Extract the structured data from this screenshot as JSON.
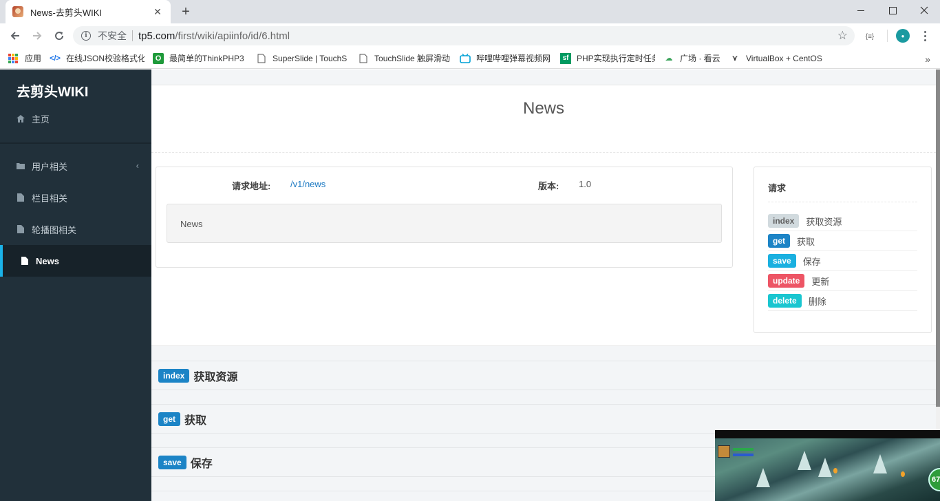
{
  "browser": {
    "tab_title": "News-去剪头WIKI",
    "address": {
      "security_label": "不安全",
      "host": "tp5.com",
      "path": "/first/wiki/apiinfo/id/6.html"
    },
    "bookmarks": [
      {
        "label": "应用",
        "icon": "apps-icon"
      },
      {
        "label": "在线JSON校验格式化",
        "icon": "json-icon",
        "color": "#1a73e8"
      },
      {
        "label": "最简单的ThinkPHP3",
        "icon": "o-icon",
        "color": "#1e9a3a"
      },
      {
        "label": "SuperSlide | TouchS",
        "icon": "page-icon"
      },
      {
        "label": "TouchSlide 触屏滑动",
        "icon": "page-icon"
      },
      {
        "label": "哔哩哔哩弹幕视频网",
        "icon": "bilibili-icon",
        "color": "#00a1d6"
      },
      {
        "label": "PHP实现执行定时任务",
        "icon": "sf-icon",
        "color": "#009a61"
      },
      {
        "label": "广场 · 看云",
        "icon": "cloud-icon",
        "color": "#3aa35a"
      },
      {
        "label": "VirtualBox + CentOS",
        "icon": "virtualbox-icon"
      }
    ]
  },
  "sidebar": {
    "brand": "去剪头WIKI",
    "home": "主页",
    "items": [
      {
        "label": "用户相关",
        "icon": "folder-icon",
        "has_submenu": true
      },
      {
        "label": "栏目相关",
        "icon": "file-icon"
      },
      {
        "label": "轮播图相关",
        "icon": "file-icon"
      },
      {
        "label": "News",
        "icon": "file-icon",
        "active": true
      }
    ]
  },
  "main": {
    "title": "News",
    "info": {
      "request_label": "请求地址:",
      "request_url": "/v1/news",
      "version_label": "版本:",
      "version": "1.0",
      "description": "News"
    },
    "methods": {
      "heading": "请求",
      "items": [
        {
          "tag": "index",
          "label": "获取资源",
          "color": "#d1dade"
        },
        {
          "tag": "get",
          "label": "获取",
          "color": "#1c84c6"
        },
        {
          "tag": "save",
          "label": "保存",
          "color": "#1ab0e0"
        },
        {
          "tag": "update",
          "label": "更新",
          "color": "#ed5565"
        },
        {
          "tag": "delete",
          "label": "删除",
          "color": "#1ac6d0"
        }
      ]
    },
    "sections": [
      {
        "tag": "index",
        "title": "获取资源"
      },
      {
        "tag": "get",
        "title": "获取"
      },
      {
        "tag": "save",
        "title": "保存"
      }
    ]
  },
  "overlay": {
    "game_level": "67"
  }
}
